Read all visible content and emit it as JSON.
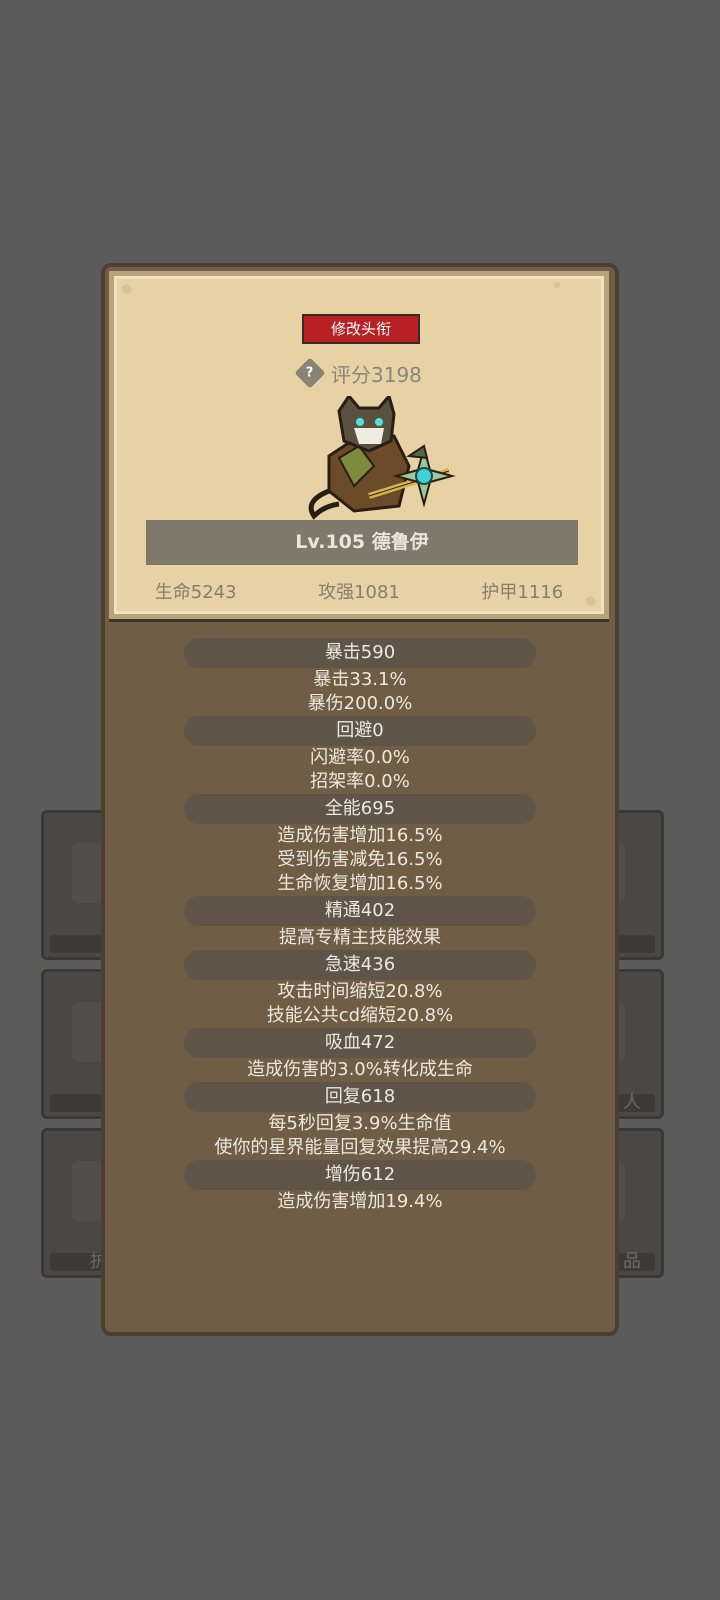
{
  "bg_slots": {
    "left_bottom_label": "护",
    "right_middle_label": "人",
    "right_bottom_label": "品"
  },
  "card": {
    "title_button": "修改头衔",
    "score": "评分3198",
    "help_icon": "?",
    "name": "Lv.105 德鲁伊",
    "stats": {
      "hp": "生命5243",
      "attack": "攻强1081",
      "armor": "护甲1116"
    }
  },
  "stats": [
    {
      "header": "暴击590",
      "lines": [
        "暴击33.1%",
        "暴伤200.0%"
      ]
    },
    {
      "header": "回避0",
      "lines": [
        "闪避率0.0%",
        "招架率0.0%"
      ]
    },
    {
      "header": "全能695",
      "lines": [
        "造成伤害增加16.5%",
        "受到伤害减免16.5%",
        "生命恢复增加16.5%"
      ]
    },
    {
      "header": "精通402",
      "lines": [
        "提高专精主技能效果"
      ]
    },
    {
      "header": "急速436",
      "lines": [
        "攻击时间缩短20.8%",
        "技能公共cd缩短20.8%"
      ]
    },
    {
      "header": "吸血472",
      "lines": [
        "造成伤害的3.0%转化成生命"
      ]
    },
    {
      "header": "回复618",
      "lines": [
        "每5秒回复3.9%生命值",
        "使你的星界能量回复效果提高29.4%"
      ]
    },
    {
      "header": "增伤612",
      "lines": [
        "造成伤害增加19.4%"
      ]
    }
  ]
}
